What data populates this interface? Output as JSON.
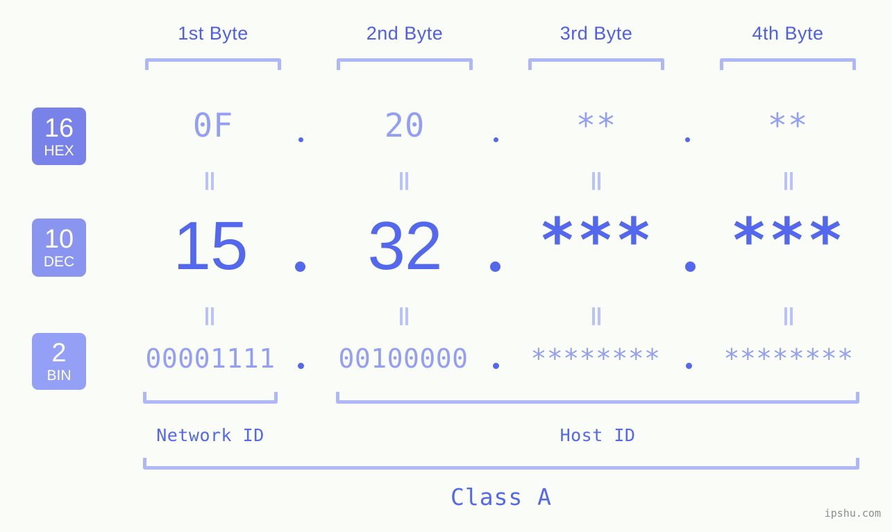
{
  "page": {
    "background_color": "#FAFCF7",
    "accent_color": "#5468EE",
    "muted_accent_color": "#939FF4",
    "bracket_color": "#AEB8F9",
    "watermark": "ipshu.com"
  },
  "columns": [
    {
      "header": "1st Byte"
    },
    {
      "header": "2nd Byte"
    },
    {
      "header": "3rd Byte"
    },
    {
      "header": "4th Byte"
    }
  ],
  "rows": [
    {
      "base": "16",
      "base_name": "HEX",
      "badge_color": "#7882E8",
      "values": [
        "0F",
        "20",
        "**",
        "**"
      ],
      "separator": "."
    },
    {
      "base": "10",
      "base_name": "DEC",
      "badge_color": "#8A95F0",
      "values": [
        "15",
        "32",
        "***",
        "***"
      ],
      "separator": "."
    },
    {
      "base": "2",
      "base_name": "BIN",
      "badge_color": "#93A0F6",
      "values": [
        "00001111",
        "00100000",
        "********",
        "********"
      ],
      "separator": "."
    }
  ],
  "equals_symbol": "=",
  "segments": {
    "network_id": "Network ID",
    "host_id": "Host ID",
    "class": "Class A"
  }
}
